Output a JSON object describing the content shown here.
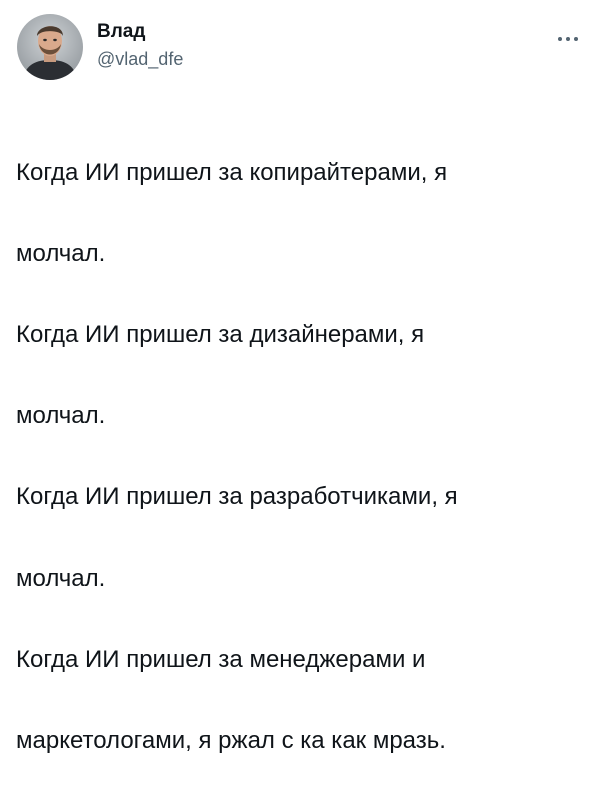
{
  "author": {
    "display_name": "Влад",
    "handle": "@vlad_dfe",
    "avatar_icon": "user-avatar-photo"
  },
  "tweet": {
    "lines": [
      "Когда ИИ пришел за копирайтерами, я",
      "молчал.",
      "Когда ИИ пришел за дизайнерами, я",
      "молчал.",
      "Когда ИИ пришел за разработчиками, я",
      "молчал.",
      "Когда ИИ пришел за менеджерами и",
      "маркетологами, я ржал с ка как мразь."
    ]
  },
  "colors": {
    "text": "#0f1419",
    "secondary": "#536471",
    "background": "#ffffff"
  },
  "icons": {
    "more": "more-horizontal-icon"
  }
}
